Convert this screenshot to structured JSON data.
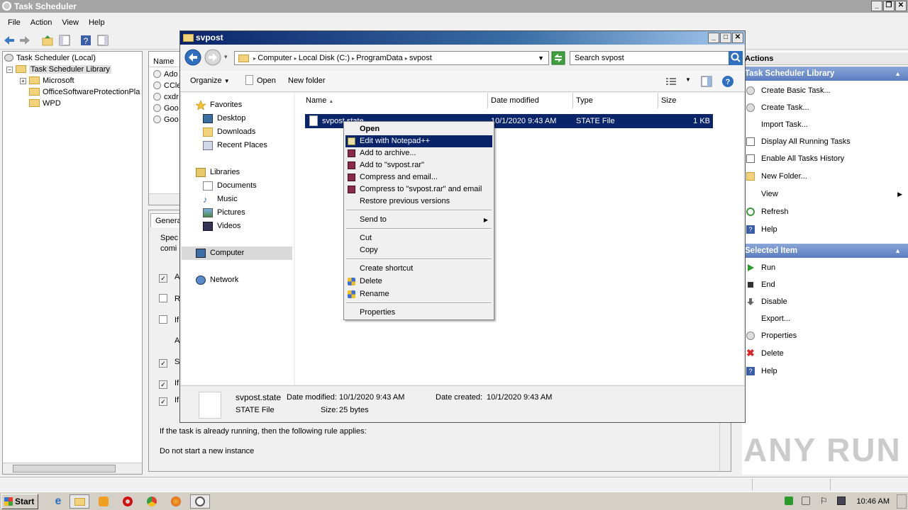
{
  "main_window": {
    "title": "Task Scheduler",
    "menu": [
      "File",
      "Action",
      "View",
      "Help"
    ]
  },
  "tree": {
    "root": "Task Scheduler (Local)",
    "library": "Task Scheduler Library",
    "children": [
      "Microsoft",
      "OfficeSoftwareProtectionPla",
      "WPD"
    ]
  },
  "task_list": {
    "column": "Name",
    "rows": [
      "Ado",
      "CCle",
      "cxdr",
      "Goo",
      "Goo"
    ]
  },
  "general_panel": {
    "tab": "Genera",
    "desc_line1": "Spec",
    "desc_line2": "comi",
    "settings": [
      "A",
      "R",
      "If",
      "A",
      "S",
      "If",
      "If"
    ],
    "rule_text": "If the task is already running, then the following rule applies:",
    "rule_value": "Do not start a new instance"
  },
  "actions": {
    "header": "Actions",
    "library_header": "Task Scheduler Library",
    "library_items": [
      "Create Basic Task...",
      "Create Task...",
      "Import Task...",
      "Display All Running Tasks",
      "Enable All Tasks History",
      "New Folder...",
      "View",
      "Refresh",
      "Help"
    ],
    "selected_header": "Selected Item",
    "selected_items": [
      "Run",
      "End",
      "Disable",
      "Export...",
      "Properties",
      "Delete",
      "Help"
    ]
  },
  "explorer": {
    "title": "svpost",
    "breadcrumb": [
      "Computer",
      "Local Disk (C:)",
      "ProgramData",
      "svpost"
    ],
    "search_placeholder": "Search svpost",
    "commands": {
      "organize": "Organize",
      "open": "Open",
      "new_folder": "New folder"
    },
    "nav": {
      "favorites": "Favorites",
      "favorites_items": [
        "Desktop",
        "Downloads",
        "Recent Places"
      ],
      "libraries": "Libraries",
      "libraries_items": [
        "Documents",
        "Music",
        "Pictures",
        "Videos"
      ],
      "computer": "Computer",
      "network": "Network"
    },
    "columns": [
      "Name",
      "Date modified",
      "Type",
      "Size"
    ],
    "file": {
      "name": "svpost.state",
      "modified": "10/1/2020 9:43 AM",
      "type": "STATE File",
      "size": "1 KB"
    },
    "details": {
      "name": "svpost.state",
      "modified_label": "Date modified:",
      "modified": "10/1/2020 9:43 AM",
      "created_label": "Date created:",
      "created": "10/1/2020 9:43 AM",
      "type": "STATE File",
      "size_label": "Size:",
      "size": "25 bytes"
    }
  },
  "context_menu": {
    "open": "Open",
    "edit_npp": "Edit with Notepad++",
    "add_archive": "Add to archive...",
    "add_rar": "Add to \"svpost.rar\"",
    "compress_email": "Compress and email...",
    "compress_rar_email": "Compress to \"svpost.rar\" and email",
    "restore": "Restore previous versions",
    "send_to": "Send to",
    "cut": "Cut",
    "copy": "Copy",
    "create_shortcut": "Create shortcut",
    "delete": "Delete",
    "rename": "Rename",
    "properties": "Properties"
  },
  "taskbar": {
    "start": "Start",
    "clock": "10:46 AM"
  },
  "watermark": "ANY RUN",
  "colors": {
    "selection": "#0a246a",
    "title_gradient_start": "#0a246a",
    "actions_header": "#5b7cc0"
  }
}
